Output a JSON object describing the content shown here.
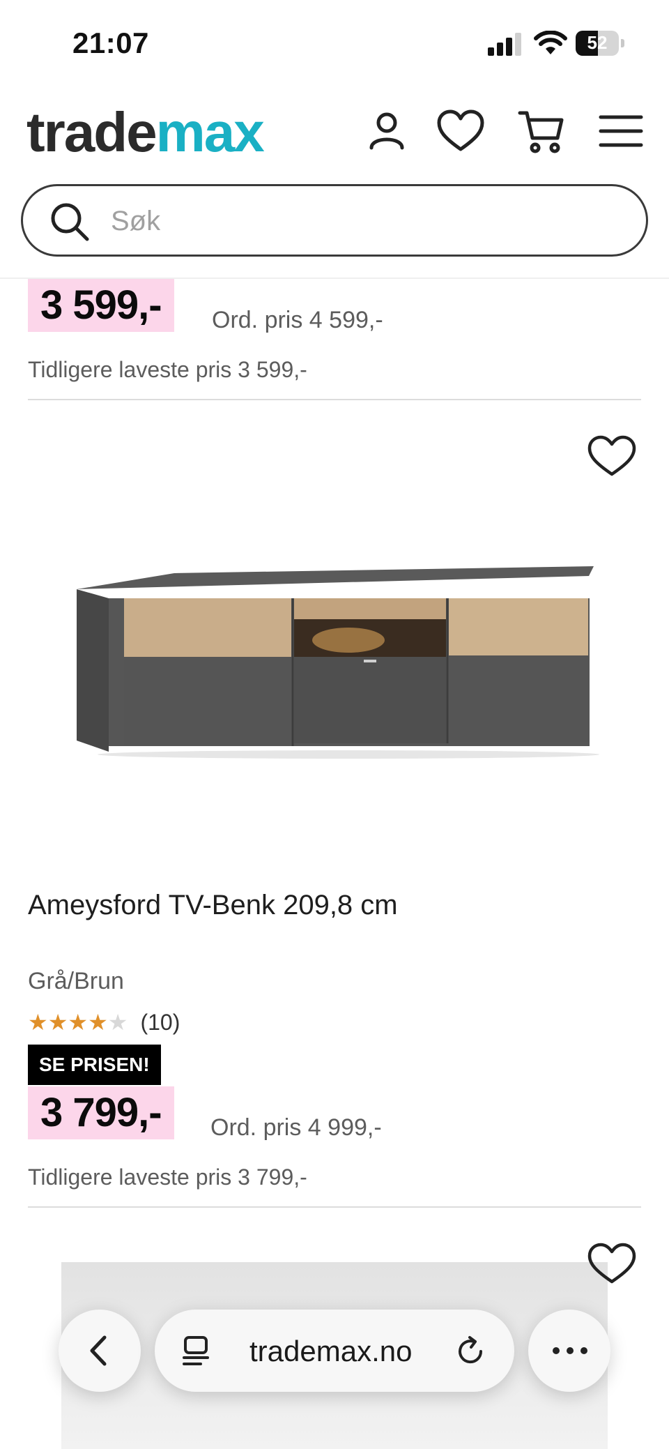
{
  "status_bar": {
    "time": "21:07",
    "battery": "52",
    "battery_level": 0.52
  },
  "header": {
    "logo_part1": "trade",
    "logo_part2": "max",
    "search_placeholder": "Søk",
    "icons": [
      "account-icon",
      "heart-icon",
      "cart-icon",
      "menu-icon"
    ]
  },
  "prev_product": {
    "price": "3 599,-",
    "ord_price": "Ord. pris 4 599,-",
    "previous_lowest": "Tidligere laveste pris 3 599,-"
  },
  "product": {
    "title": "Ameysford TV-Benk 209,8 cm",
    "color": "Grå/Brun",
    "rating": 4,
    "rating_max": 5,
    "review_count": "(10)",
    "badge": "SE PRISEN!",
    "price": "3 799,-",
    "ord_price": "Ord. pris 4 999,-",
    "previous_lowest": "Tidligere laveste pris 3 799,-"
  },
  "browser_bar": {
    "url": "trademax.no"
  },
  "colors": {
    "brand_dark": "#2b2b2b",
    "brand_teal": "#1ab0c4",
    "price_highlight": "#fcd6ea",
    "star": "#e0902a",
    "badge": "#000000"
  }
}
